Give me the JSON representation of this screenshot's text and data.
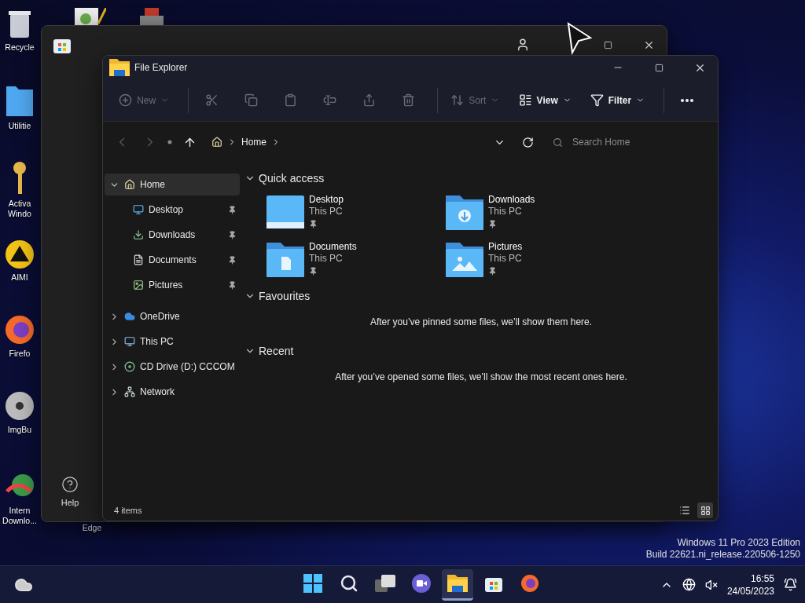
{
  "desktop_icons": [
    {
      "kind": "bin",
      "label": "Recycle"
    },
    {
      "kind": "folder",
      "label": "Utilitie"
    },
    {
      "kind": "key",
      "label": "Activa Windo"
    },
    {
      "kind": "player",
      "label": "AIMI"
    },
    {
      "kind": "browser",
      "label": "Firefo"
    },
    {
      "kind": "disc",
      "label": "ImgBu"
    },
    {
      "kind": "downloader",
      "label": "Intern Downlo..."
    },
    {
      "kind": "edge",
      "label": "Edge"
    }
  ],
  "store_window": {
    "help_label": "Help"
  },
  "explorer": {
    "title": "File Explorer",
    "toolbar": [
      {
        "kind": "new",
        "label": "New",
        "disabled": true
      },
      {
        "kind": "cut",
        "disabled": true
      },
      {
        "kind": "copy",
        "disabled": true
      },
      {
        "kind": "paste",
        "disabled": true
      },
      {
        "kind": "rename",
        "disabled": true
      },
      {
        "kind": "share",
        "disabled": true
      },
      {
        "kind": "delete",
        "disabled": true
      },
      {
        "kind": "sort",
        "label": "Sort",
        "disabled": true
      },
      {
        "kind": "view",
        "label": "View",
        "disabled": false
      },
      {
        "kind": "filter",
        "label": "Filter",
        "disabled": false
      },
      {
        "kind": "more",
        "disabled": false
      }
    ],
    "address": {
      "path": "Home",
      "search_placeholder": "Search Home"
    },
    "sidebar": [
      {
        "kind": "home",
        "label": "Home",
        "selected": true,
        "expanded": true,
        "children": [
          {
            "kind": "desktop",
            "label": "Desktop",
            "pinned": true
          },
          {
            "kind": "downloads",
            "label": "Downloads",
            "pinned": true
          },
          {
            "kind": "documents",
            "label": "Documents",
            "pinned": true
          },
          {
            "kind": "pictures",
            "label": "Pictures",
            "pinned": true
          }
        ]
      },
      {
        "kind": "onedrive",
        "label": "OneDrive",
        "selected": false,
        "expanded": false
      },
      {
        "kind": "pc",
        "label": "This PC",
        "selected": false,
        "expanded": false
      },
      {
        "kind": "cd",
        "label": "CD Drive (D:) CCCOM",
        "selected": false,
        "expanded": false
      },
      {
        "kind": "network",
        "label": "Network",
        "selected": false,
        "expanded": false
      }
    ],
    "sections": [
      {
        "title": "Quick access",
        "expanded": true,
        "items": [
          {
            "kind": "desktop",
            "name": "Desktop",
            "location": "This PC",
            "pinned": true
          },
          {
            "kind": "downloads",
            "name": "Downloads",
            "location": "This PC",
            "pinned": true
          },
          {
            "kind": "documents",
            "name": "Documents",
            "location": "This PC",
            "pinned": true
          },
          {
            "kind": "pictures",
            "name": "Pictures",
            "location": "This PC",
            "pinned": true
          }
        ]
      },
      {
        "title": "Favourites",
        "expanded": true,
        "message": "After you’ve pinned some files, we’ll show them here."
      },
      {
        "title": "Recent",
        "expanded": true,
        "message": "After you’ve opened some files, we’ll show the most recent ones here."
      }
    ],
    "status": "4 items",
    "view_modes": [
      {
        "kind": "details",
        "selected": false
      },
      {
        "kind": "tiles",
        "selected": true
      }
    ]
  },
  "edition": [
    "Windows 11 Pro 2023 Edition",
    "Build 22621.ni_release.220506-1250"
  ],
  "taskbar": {
    "apps": [
      {
        "kind": "start",
        "active": false
      },
      {
        "kind": "search",
        "active": false
      },
      {
        "kind": "taskview",
        "active": false
      },
      {
        "kind": "chat",
        "active": false
      },
      {
        "kind": "explorer",
        "active": true
      },
      {
        "kind": "store",
        "active": false
      },
      {
        "kind": "firefox",
        "active": false
      }
    ],
    "time": "16:55",
    "date": "24/05/2023"
  }
}
